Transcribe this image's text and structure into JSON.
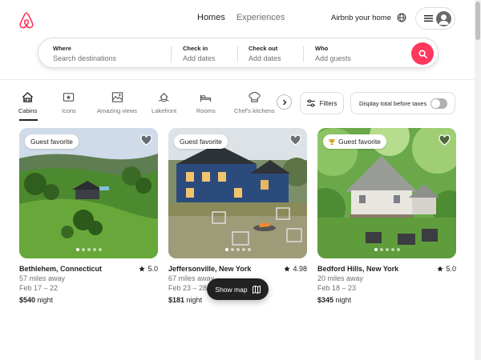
{
  "header": {
    "nav": [
      "Homes",
      "Experiences"
    ],
    "host_link": "Airbnb your home"
  },
  "search": {
    "where": {
      "label": "Where",
      "placeholder": "Search destinations"
    },
    "checkin": {
      "label": "Check in",
      "placeholder": "Add dates"
    },
    "checkout": {
      "label": "Check out",
      "placeholder": "Add dates"
    },
    "who": {
      "label": "Who",
      "placeholder": "Add guests"
    }
  },
  "categories": [
    {
      "label": "Cabins",
      "icon": "cabin-icon",
      "active": true
    },
    {
      "label": "Icons",
      "icon": "icons-icon"
    },
    {
      "label": "Amazing views",
      "icon": "amazing-views-icon"
    },
    {
      "label": "Lakefront",
      "icon": "lakefront-icon"
    },
    {
      "label": "Rooms",
      "icon": "rooms-icon"
    },
    {
      "label": "Chef's kitchens",
      "icon": "chefs-kitchen-icon"
    }
  ],
  "filters_label": "Filters",
  "tax_label": "Display total before taxes",
  "listings": [
    {
      "badge": "Guest favorite",
      "title": "Bethlehem, Connecticut",
      "rating": "5.0",
      "distance": "57 miles away",
      "dates": "Feb 17 – 22",
      "price": "$540",
      "price_unit": "night"
    },
    {
      "badge": "Guest favorite",
      "title": "Jeffersonville, New York",
      "rating": "4.98",
      "distance": "67 miles away",
      "dates": "Feb 23 – 28",
      "price": "$181",
      "price_unit": "night"
    },
    {
      "badge": "Guest favorite",
      "title": "Bedford Hills, New York",
      "rating": "5.0",
      "distance": "20 miles away",
      "dates": "Feb 18 – 23",
      "price": "$345",
      "price_unit": "night"
    }
  ],
  "show_map_label": "Show map",
  "colors": {
    "brand": "#ff385c",
    "text": "#222222",
    "muted": "#717171"
  }
}
